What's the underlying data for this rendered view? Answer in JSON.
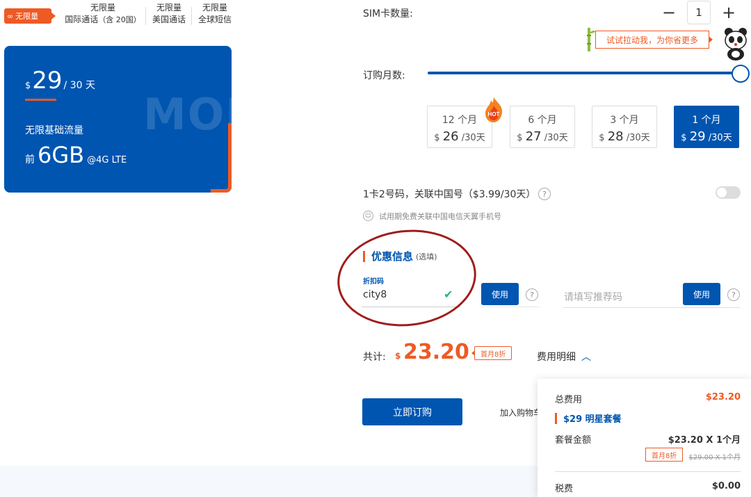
{
  "features": {
    "badge": "无限量",
    "items": [
      {
        "top": "无限量",
        "bottom": "国际通话",
        "note": "（含 20国）"
      },
      {
        "top": "无限量",
        "bottom": "美国通话"
      },
      {
        "top": "无限量",
        "bottom": "全球短信"
      }
    ]
  },
  "card": {
    "currency": "$",
    "price": "29",
    "period": "/ 30 天",
    "line1": "无限基础流量",
    "line2_pre": "前",
    "line2_amount": "6GB",
    "line2_net": "@4G LTE",
    "watermark": "MORE"
  },
  "sim": {
    "label": "SIM卡数量:",
    "minus": "−",
    "qty": "1",
    "plus": "+"
  },
  "tip": "试试拉动我，为你省更多",
  "months": {
    "label": "订购月数:",
    "slider_value": 1,
    "hot": "HOT",
    "options": [
      {
        "months": "12 个月",
        "currency": "$",
        "price": "26",
        "per": "/30天"
      },
      {
        "months": "6 个月",
        "currency": "$",
        "price": "27",
        "per": "/30天"
      },
      {
        "months": "3 个月",
        "currency": "$",
        "price": "28",
        "per": "/30天"
      },
      {
        "months": "1 个月",
        "currency": "$",
        "price": "29",
        "per": "/30天"
      }
    ]
  },
  "dual": {
    "label": "1卡2号码，关联中国号（$3.99/30天）",
    "help": "?",
    "toggle_on": false,
    "note": "试用期免费关联中国电信天翼手机号"
  },
  "promo": {
    "title": "优惠信息",
    "optional": "(选填)",
    "code_label": "折扣码",
    "code_value": "city8",
    "check": "✔",
    "use": "使用",
    "help": "?",
    "referral_placeholder": "请填写推荐码"
  },
  "total": {
    "label": "共计:",
    "currency": "$",
    "amount": "23.20",
    "tag": "首月8折",
    "detail": "费用明细",
    "chevron": "︿"
  },
  "actions": {
    "buy": "立即订购",
    "cart": "加入购物车"
  },
  "breakdown": {
    "total_label": "总费用",
    "total_value": "$23.20",
    "plan_name": "$29 明星套餐",
    "plan_amount_label": "套餐金额",
    "plan_amount_value": "$23.20 X 1个月",
    "tag": "首月8折",
    "original": "$29.00 X 1个月",
    "tax_label": "税费",
    "tax_value": "$0.00"
  },
  "colors": {
    "brand_blue": "#0055b0",
    "accent_orange": "#ee5a24",
    "check_green": "#20b87a"
  }
}
